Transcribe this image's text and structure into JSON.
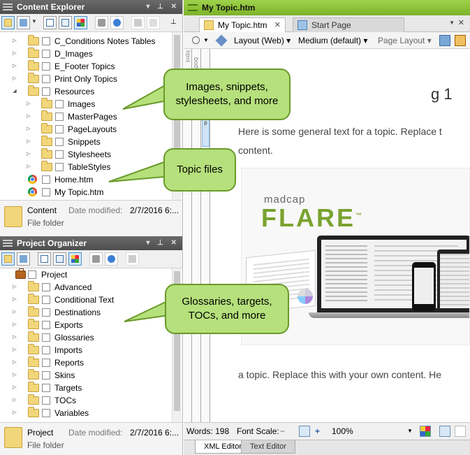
{
  "content_explorer": {
    "title": "Content Explorer",
    "items": [
      {
        "label": "C_Conditions Notes Tables",
        "type": "folder",
        "expander": "▷",
        "level": 1
      },
      {
        "label": "D_Images",
        "type": "folder",
        "expander": "▷",
        "level": 1
      },
      {
        "label": "E_Footer Topics",
        "type": "folder",
        "expander": "▷",
        "level": 1
      },
      {
        "label": "Print Only Topics",
        "type": "folder",
        "expander": "▷",
        "level": 1
      },
      {
        "label": "Resources",
        "type": "folder",
        "expander": "◢",
        "level": 1
      },
      {
        "label": "Images",
        "type": "folder",
        "expander": "▷",
        "level": 2
      },
      {
        "label": "MasterPages",
        "type": "folder",
        "expander": "▷",
        "level": 2
      },
      {
        "label": "PageLayouts",
        "type": "folder",
        "expander": "▷",
        "level": 2
      },
      {
        "label": "Snippets",
        "type": "folder",
        "expander": "▷",
        "level": 2
      },
      {
        "label": "Stylesheets",
        "type": "folder",
        "expander": "▷",
        "level": 2
      },
      {
        "label": "TableStyles",
        "type": "folder",
        "expander": "▷",
        "level": 2
      },
      {
        "label": "Home.htm",
        "type": "file",
        "expander": "",
        "level": 1
      },
      {
        "label": "My Topic.htm",
        "type": "file",
        "expander": "",
        "level": 1
      }
    ],
    "info": {
      "name": "Content",
      "type": "File folder",
      "date_label": "Date modified:",
      "date_value": "2/7/2016 6:..."
    }
  },
  "project_organizer": {
    "title": "Project Organizer",
    "root": "Project",
    "items": [
      {
        "label": "Advanced",
        "expander": "▷"
      },
      {
        "label": "Conditional Text",
        "expander": "▷"
      },
      {
        "label": "Destinations",
        "expander": "▷"
      },
      {
        "label": "Exports",
        "expander": "▷"
      },
      {
        "label": "Glossaries",
        "expander": "▷"
      },
      {
        "label": "Imports",
        "expander": "▷"
      },
      {
        "label": "Reports",
        "expander": "▷"
      },
      {
        "label": "Skins",
        "expander": "▷"
      },
      {
        "label": "Targets",
        "expander": "▷"
      },
      {
        "label": "TOCs",
        "expander": "▷"
      },
      {
        "label": "Variables",
        "expander": "▷"
      }
    ],
    "info": {
      "name": "Project",
      "type": "File folder",
      "date_label": "Date modified:",
      "date_value": "2/7/2016 6:..."
    }
  },
  "editor": {
    "title": "My Topic.htm",
    "tabs": [
      {
        "label": "My Topic.htm",
        "close": "✕",
        "active": true
      },
      {
        "label": "Start Page",
        "active": false
      }
    ],
    "toolbar": {
      "layout": "Layout (Web)",
      "medium": "Medium (default)",
      "page_layout": "Page Layout"
    },
    "gutter": {
      "html": "html",
      "body": "body",
      "p": "p"
    },
    "heading": "g 1",
    "para1": "Here is some general text for a topic. Replace t",
    "para1_cont": "content.",
    "banner": {
      "madcap": "madcap",
      "flare": "FLARE",
      "tm": "™"
    },
    "para2": "a topic. Replace this with your own content. He",
    "status": {
      "words": "Words: 198",
      "font_scale": "Font Scale:",
      "minus": "−",
      "plus": "+",
      "zoom": "100%"
    },
    "bottom_tabs": [
      "XML Editor",
      "Text Editor"
    ]
  },
  "callouts": [
    {
      "text": "Images, snippets, stylesheets, and more"
    },
    {
      "text": "Topic files"
    },
    {
      "text": "Glossaries, targets, TOCs, and more"
    }
  ],
  "colors": {
    "callout_fill": "#b5e07c",
    "callout_border": "#6a9a2a",
    "editor_title": "#8cc43a",
    "flare_green": "#7aa22f"
  }
}
